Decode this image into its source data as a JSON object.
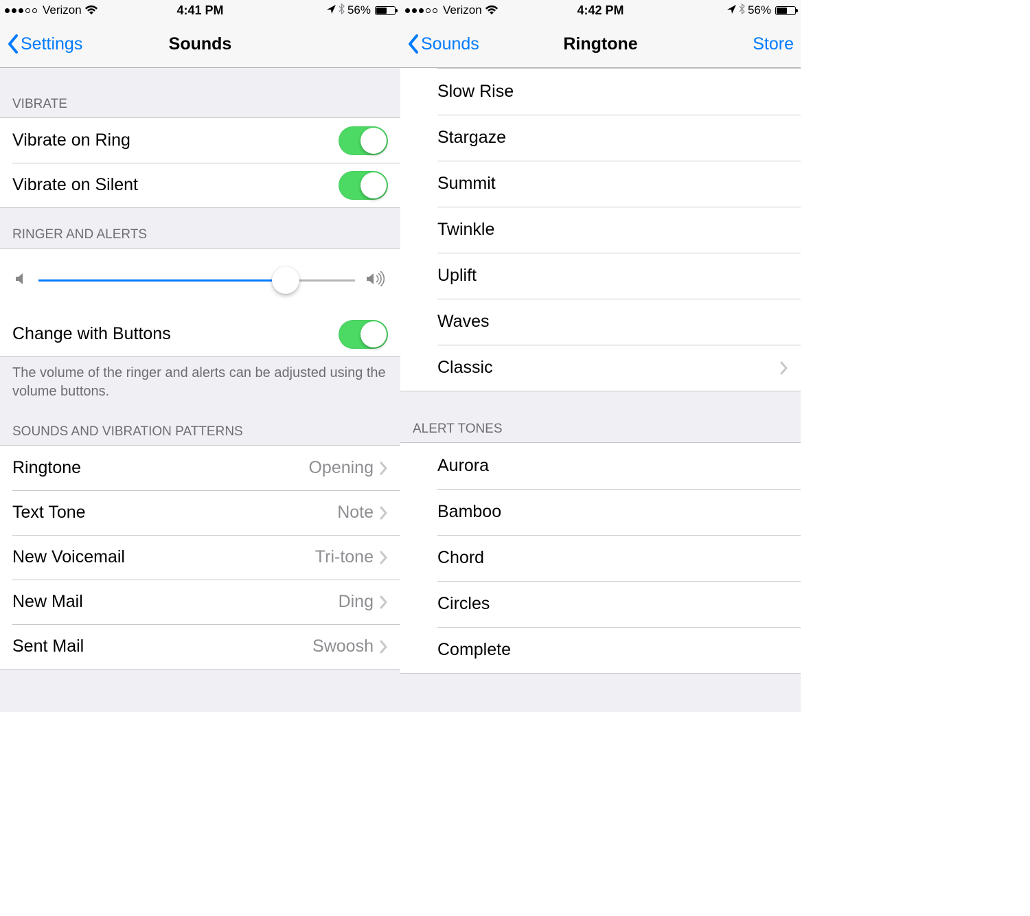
{
  "left": {
    "status": {
      "carrier": "Verizon",
      "time": "4:41 PM",
      "battery": "56%",
      "signal_filled": 3,
      "signal_total": 5
    },
    "nav": {
      "back": "Settings",
      "title": "Sounds"
    },
    "vibrate": {
      "header": "Vibrate",
      "rows": [
        {
          "label": "Vibrate on Ring",
          "on": true
        },
        {
          "label": "Vibrate on Silent",
          "on": true
        }
      ]
    },
    "ringer": {
      "header": "Ringer and Alerts",
      "volume_percent": 78,
      "change_label": "Change with Buttons",
      "change_on": true,
      "footer": "The volume of the ringer and alerts can be adjusted using the volume buttons."
    },
    "patterns": {
      "header": "Sounds and Vibration Patterns",
      "rows": [
        {
          "label": "Ringtone",
          "value": "Opening"
        },
        {
          "label": "Text Tone",
          "value": "Note"
        },
        {
          "label": "New Voicemail",
          "value": "Tri-tone"
        },
        {
          "label": "New Mail",
          "value": "Ding"
        },
        {
          "label": "Sent Mail",
          "value": "Swoosh"
        }
      ]
    }
  },
  "right": {
    "status": {
      "carrier": "Verizon",
      "time": "4:42 PM",
      "battery": "56%",
      "signal_filled": 3,
      "signal_total": 5
    },
    "nav": {
      "back": "Sounds",
      "title": "Ringtone",
      "right": "Store"
    },
    "ringtones": [
      "Slow Rise",
      "Stargaze",
      "Summit",
      "Twinkle",
      "Uplift",
      "Waves"
    ],
    "classic": "Classic",
    "alert_header": "Alert Tones",
    "alert_tones": [
      "Aurora",
      "Bamboo",
      "Chord",
      "Circles",
      "Complete"
    ]
  }
}
